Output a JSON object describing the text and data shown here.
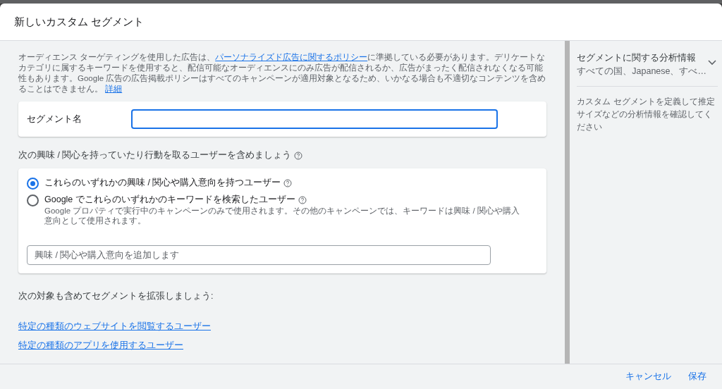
{
  "dialog": {
    "title": "新しいカスタム セグメント"
  },
  "policy": {
    "text_before": "オーディエンス ターゲティングを使用した広告は、",
    "link": "パーソナライズド広告に関するポリシー",
    "text_after": "に準拠している必要があります。デリケートなカテゴリに属するキーワードを使用すると、配信可能なオーディエンスにのみ広告が配信されるか、広告がまったく配信されなくなる可能性もあります。Google 広告の広告掲載ポリシーはすべてのキャンペーンが適用対象となるため、いかなる場合も不適切なコンテンツを含めることはできません。",
    "more_link": "詳細"
  },
  "segment_name": {
    "label": "セグメント名"
  },
  "include": {
    "heading": "次の興味 / 関心を持っていたり行動を取るユーザーを含めましょう",
    "options": [
      {
        "label": "これらのいずれかの興味 / 関心や購入意向を持つユーザー",
        "selected": true
      },
      {
        "label": "Google でこれらのいずれかのキーワードを検索したユーザー",
        "selected": false,
        "description": "Google プロパティで実行中のキャンペーンのみで使用されます。その他のキャンペーンでは、キーワードは興味 / 関心や購入意向として使用されます。"
      }
    ],
    "field": {
      "placeholder": "興味 / 関心や購入意向を追加します"
    }
  },
  "expand": {
    "heading": "次の対象も含めてセグメントを拡張しましょう:",
    "links": [
      "特定の種類のウェブサイトを閲覧するユーザー",
      "特定の種類のアプリを使用するユーザー"
    ]
  },
  "insights": {
    "title": "セグメントに関する分析情報",
    "subtitle": "すべての国、Japanese、すべ…",
    "description": "カスタム セグメントを定義して推定サイズなどの分析情報を確認してください"
  },
  "buttons": [
    "キャンセル",
    "保存"
  ]
}
